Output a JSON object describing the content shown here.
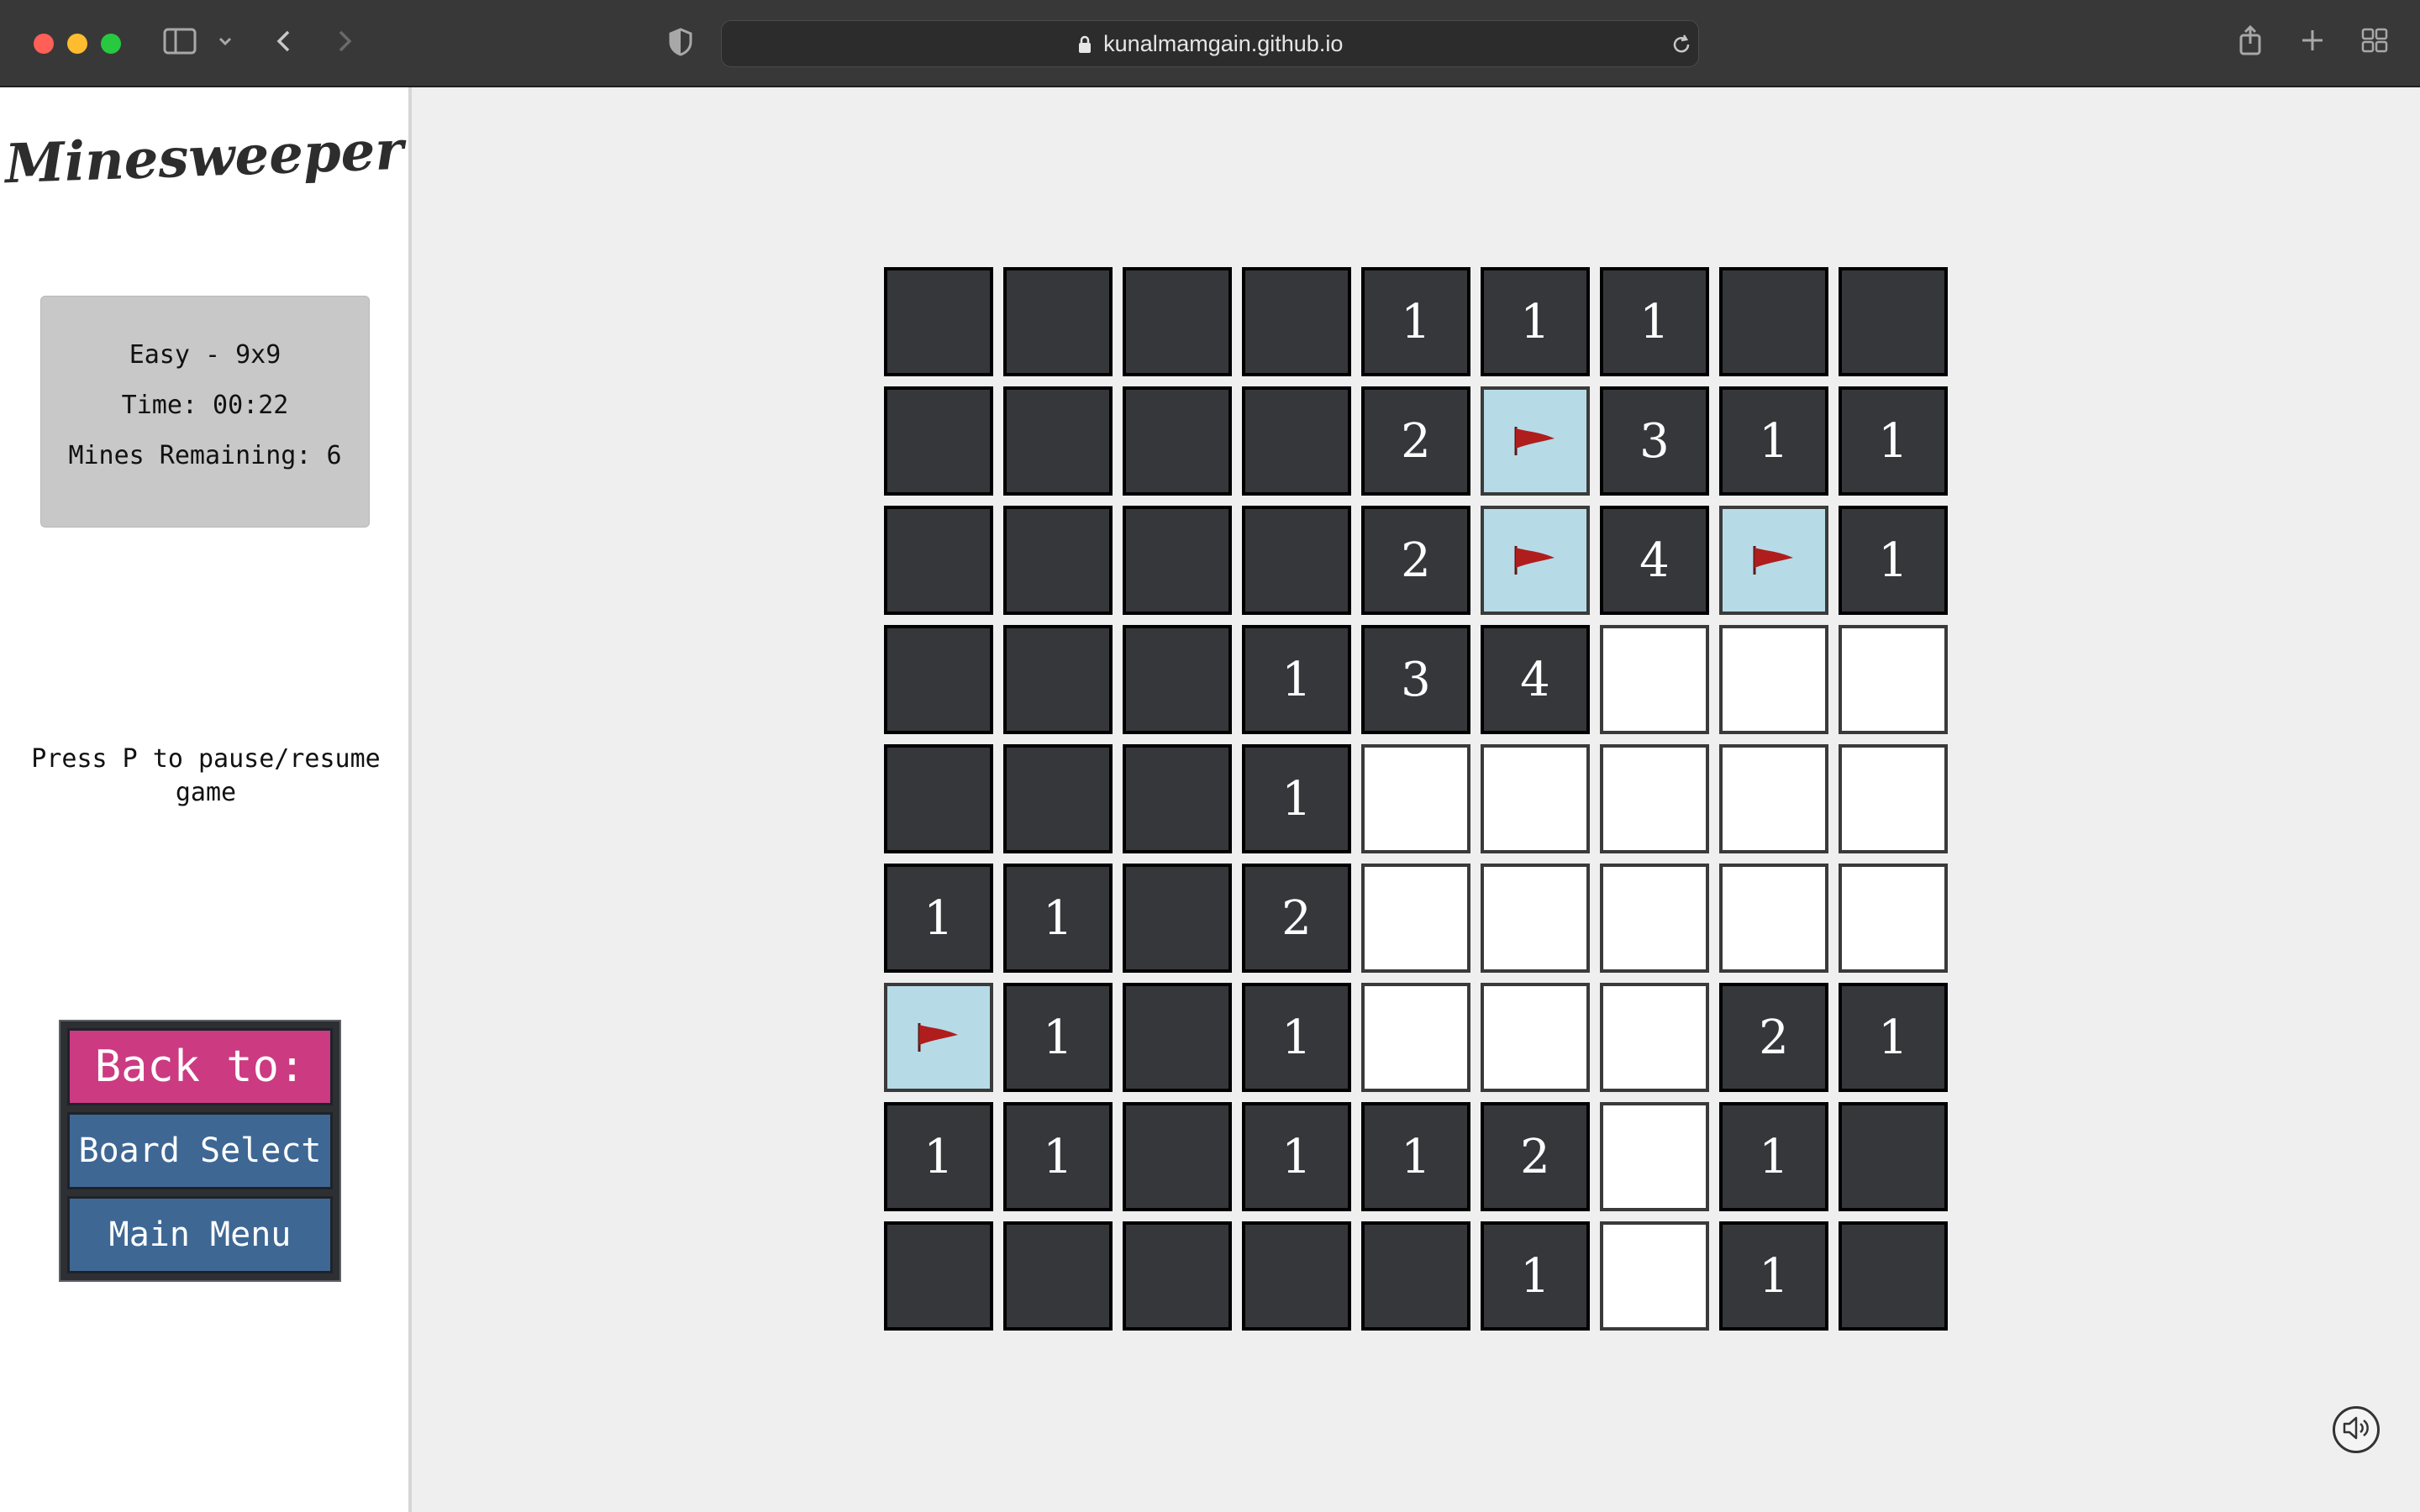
{
  "browser": {
    "url": "kunalmamgain.github.io"
  },
  "sidebar": {
    "logo": "Minesweeper",
    "info": {
      "difficulty": "Easy - 9x9",
      "time": "Time: 00:22",
      "mines_remaining": "Mines Remaining: 6"
    },
    "pause_hint": "Press P to pause/resume game",
    "nav": {
      "back_label": "Back to:",
      "board_select": "Board Select",
      "main_menu": "Main Menu"
    }
  },
  "board": {
    "size": "9x9",
    "legend": {
      "X": "unrevealed",
      "E": "empty",
      "F": "flag",
      "1-9": "number"
    },
    "rows": [
      [
        "X",
        "X",
        "X",
        "X",
        "1",
        "1",
        "1",
        "X",
        "X"
      ],
      [
        "X",
        "X",
        "X",
        "X",
        "2",
        "F",
        "3",
        "1",
        "1"
      ],
      [
        "X",
        "X",
        "X",
        "X",
        "2",
        "F",
        "4",
        "F",
        "1"
      ],
      [
        "X",
        "X",
        "X",
        "1",
        "3",
        "4",
        "E",
        "E",
        "E"
      ],
      [
        "X",
        "X",
        "X",
        "1",
        "E",
        "E",
        "E",
        "E",
        "E"
      ],
      [
        "1",
        "1",
        "X",
        "2",
        "E",
        "E",
        "E",
        "E",
        "E"
      ],
      [
        "F",
        "1",
        "X",
        "1",
        "E",
        "E",
        "E",
        "2",
        "1"
      ],
      [
        "1",
        "1",
        "X",
        "1",
        "1",
        "2",
        "E",
        "1",
        "X"
      ],
      [
        "X",
        "X",
        "X",
        "X",
        "X",
        "1",
        "E",
        "1",
        "X"
      ]
    ]
  },
  "colors": {
    "cell_dark": "#35373b",
    "cell_empty": "#ffffff",
    "cell_flag": "#b6dbe7",
    "flag": "#b01d1d",
    "back_button": "#cc3a82",
    "nav_button": "#3e6794"
  },
  "icons": {
    "flag": "flag-icon",
    "sound": "speaker-icon"
  }
}
